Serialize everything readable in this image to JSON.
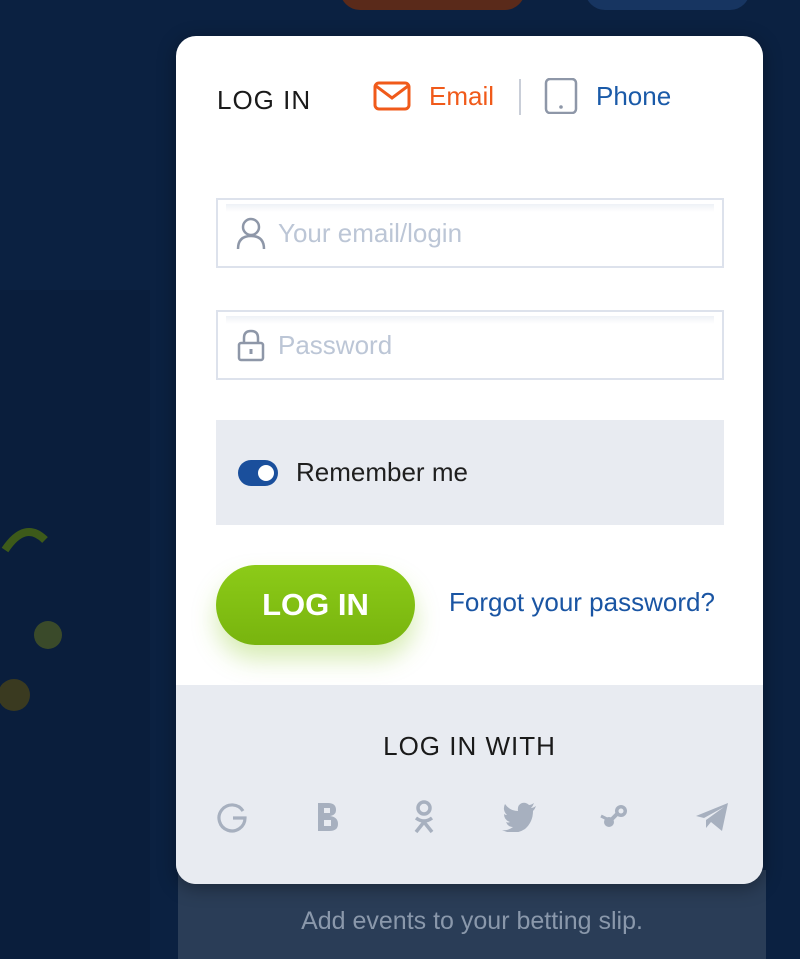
{
  "modal": {
    "title": "LOG IN",
    "tabs": [
      {
        "label": "Email",
        "icon": "envelope-icon",
        "color": "#f05a1a",
        "active": true
      },
      {
        "label": "Phone",
        "icon": "phone-icon",
        "color": "#1a5aa8",
        "active": false
      }
    ],
    "email_field": {
      "placeholder": "Your email/login",
      "value": "",
      "icon": "user-icon"
    },
    "password_field": {
      "placeholder": "Password",
      "value": "",
      "icon": "lock-icon"
    },
    "remember": {
      "label": "Remember me",
      "enabled": true
    },
    "login_button": {
      "label": "LOG IN",
      "color": "#82bf12"
    },
    "forgot_link": "Forgot your password?",
    "social": {
      "title": "LOG IN WITH",
      "providers": [
        "google-icon",
        "b-icon",
        "odnoklassniki-icon",
        "twitter-icon",
        "steam-icon",
        "telegram-icon"
      ]
    }
  },
  "background": {
    "hint_text": "Add events to your betting slip."
  },
  "colors": {
    "page_bg": "#0b2141",
    "accent_orange": "#f05a1a",
    "link_blue": "#1a55a3",
    "toggle_blue": "#1a4f9c"
  }
}
